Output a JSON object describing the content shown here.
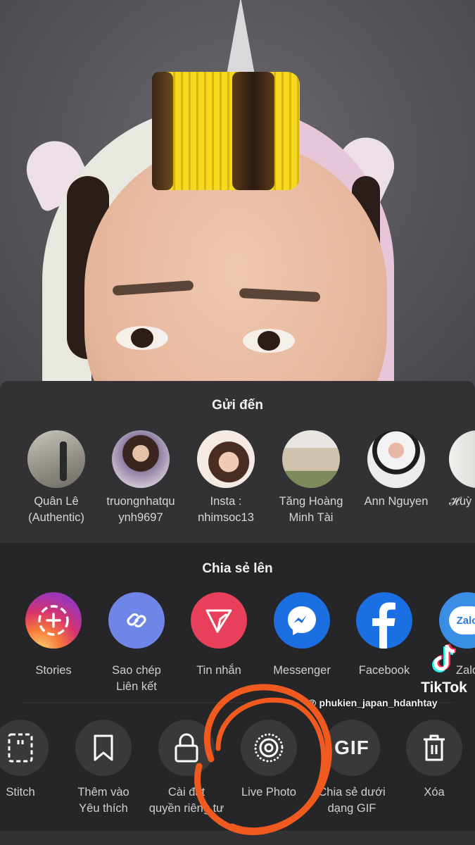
{
  "share_sheet": {
    "send_to": {
      "title": "Gửi đến",
      "contacts": [
        {
          "name_line1": "Quân Lê",
          "name_line2": "(Authentic)"
        },
        {
          "name_line1": "truongnhatqu",
          "name_line2": "ynh9697"
        },
        {
          "name_line1": "Insta :",
          "name_line2": "nhimsoc13"
        },
        {
          "name_line1": "Tăng Hoàng",
          "name_line2": "Minh Tài"
        },
        {
          "name_line1": "Ann Nguyen",
          "name_line2": ""
        },
        {
          "name_line1": "𝓗uỳ",
          "name_line2": ""
        }
      ]
    },
    "share_to": {
      "title": "Chia sẻ lên",
      "apps": [
        {
          "icon": "stories-icon",
          "label_line1": "Stories",
          "label_line2": "",
          "color": "#c13584"
        },
        {
          "icon": "link-icon",
          "label_line1": "Sao chép",
          "label_line2": "Liên kết",
          "color": "#6f86e8"
        },
        {
          "icon": "direct-message-icon",
          "label_line1": "Tin nhắn",
          "label_line2": "",
          "color": "#e8405a"
        },
        {
          "icon": "messenger-icon",
          "label_line1": "Messenger",
          "label_line2": "",
          "color": "#1c6fe0"
        },
        {
          "icon": "facebook-icon",
          "label_line1": "Facebook",
          "label_line2": "",
          "color": "#1a6fe3"
        },
        {
          "icon": "zalo-icon",
          "label_line1": "Zalo",
          "label_line2": "",
          "color": "#3a8ee6",
          "icon_text": "Zalo"
        }
      ]
    },
    "actions": [
      {
        "icon": "stitch-icon",
        "label_line1": "Stitch",
        "label_line2": ""
      },
      {
        "icon": "bookmark-icon",
        "label_line1": "Thêm vào",
        "label_line2": "Yêu thích"
      },
      {
        "icon": "lock-icon",
        "label_line1": "Cài đặt",
        "label_line2": "quyền riêng tư"
      },
      {
        "icon": "live-photo-icon",
        "label_line1": "Live Photo",
        "label_line2": ""
      },
      {
        "icon": "gif-icon",
        "label_line1": "Chia sẻ dưới",
        "label_line2": "dạng GIF",
        "icon_text": "GIF"
      },
      {
        "icon": "trash-icon",
        "label_line1": "Xóa",
        "label_line2": ""
      }
    ]
  },
  "watermark": {
    "brand": "TikTok",
    "handle": "@ phukien_japan_hdanhtay"
  },
  "annotation": {
    "color": "#f05a1e",
    "target": "Live Photo"
  }
}
